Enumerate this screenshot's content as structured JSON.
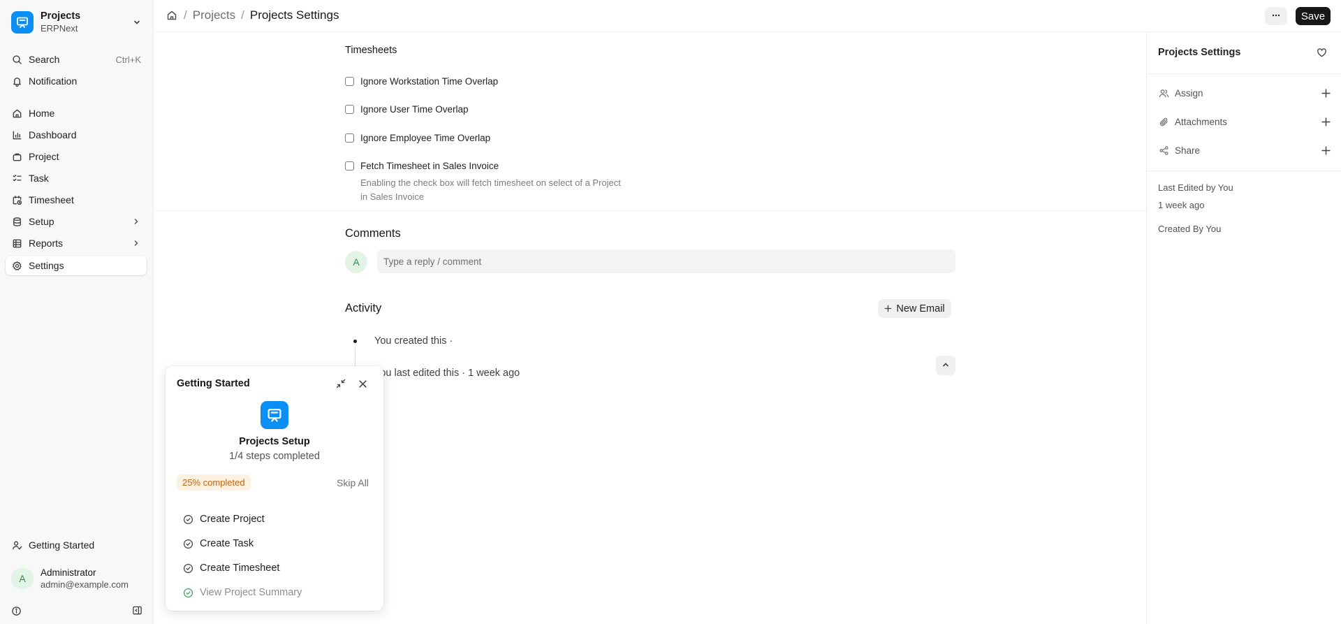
{
  "app": {
    "name": "Projects",
    "subtitle": "ERPNext"
  },
  "sidebar": {
    "search_label": "Search",
    "search_shortcut": "Ctrl+K",
    "notification_label": "Notification",
    "items": [
      {
        "label": "Home"
      },
      {
        "label": "Dashboard"
      },
      {
        "label": "Project"
      },
      {
        "label": "Task"
      },
      {
        "label": "Timesheet"
      },
      {
        "label": "Setup"
      },
      {
        "label": "Reports"
      },
      {
        "label": "Settings"
      }
    ],
    "getting_started_label": "Getting Started",
    "user": {
      "initial": "A",
      "name": "Administrator",
      "email": "admin@example.com"
    }
  },
  "topbar": {
    "crumb_parent": "Projects",
    "crumb_current": "Projects Settings",
    "save_label": "Save"
  },
  "timesheets": {
    "title": "Timesheets",
    "options": [
      {
        "label": "Ignore Workstation Time Overlap",
        "checked": false
      },
      {
        "label": "Ignore User Time Overlap",
        "checked": false
      },
      {
        "label": "Ignore Employee Time Overlap",
        "checked": false
      },
      {
        "label": "Fetch Timesheet in Sales Invoice",
        "checked": false
      }
    ],
    "fetch_description": "Enabling the check box will fetch timesheet on select of a Project in Sales Invoice"
  },
  "comments": {
    "title": "Comments",
    "avatar_initial": "A",
    "placeholder": "Type a reply / comment"
  },
  "activity": {
    "title": "Activity",
    "new_email_label": "New Email",
    "entries": [
      {
        "text": "You created this ·"
      },
      {
        "text": "You last edited this · 1 week ago"
      }
    ]
  },
  "rightbar": {
    "title": "Projects Settings",
    "assign_label": "Assign",
    "attachments_label": "Attachments",
    "share_label": "Share",
    "last_edited": "Last Edited by You",
    "last_edited_time": "1 week ago",
    "created_by": "Created By You"
  },
  "getting_started": {
    "title": "Getting Started",
    "setup_title": "Projects Setup",
    "steps_completed": "1/4 steps completed",
    "progress_badge": "25% completed",
    "progress_value": 25,
    "skip_label": "Skip All",
    "steps": [
      {
        "label": "Create Project",
        "done": false
      },
      {
        "label": "Create Task",
        "done": false
      },
      {
        "label": "Create Timesheet",
        "done": false
      },
      {
        "label": "View Project Summary",
        "done": true
      }
    ]
  },
  "colors": {
    "brand": "#0b8ff5",
    "primary_button": "#171717",
    "badge_bg": "#fdf1e1",
    "badge_text": "#c5650a",
    "success": "#38a15a"
  }
}
